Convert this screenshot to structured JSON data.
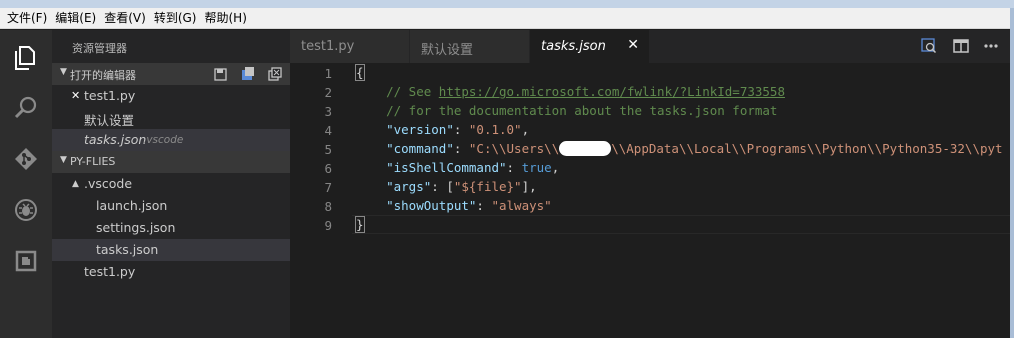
{
  "menu": [
    "文件(F)",
    "编辑(E)",
    "查看(V)",
    "转到(G)",
    "帮助(H)"
  ],
  "activity": [
    "explorer-icon",
    "search-icon",
    "git-icon",
    "debug-icon",
    "extensions-icon"
  ],
  "sidebar": {
    "title": "资源管理器",
    "open_editors": {
      "label": "打开的编辑器",
      "items": [
        {
          "close": "✕",
          "label": "test1.py"
        },
        {
          "label": "默认设置"
        },
        {
          "label": "tasks.json",
          "hint": ".vscode"
        }
      ]
    },
    "folder": {
      "label": "PY-FLIES",
      "vscode": {
        "arrow": "▲",
        "label": ".vscode"
      },
      "files": [
        "launch.json",
        "settings.json",
        "tasks.json"
      ],
      "root_file": "test1.py"
    }
  },
  "tabs": [
    {
      "label": "test1.py"
    },
    {
      "label": "默认设置"
    },
    {
      "label": "tasks.json",
      "close": "✕"
    }
  ],
  "editor": {
    "line_numbers": [
      "1",
      "2",
      "3",
      "4",
      "5",
      "6",
      "7",
      "8",
      "9"
    ],
    "open_brace": "{",
    "comment_see": "// See ",
    "link": "https://go.microsoft.com/fwlink/?LinkId=733558",
    "comment_doc": "// for the documentation about the tasks.json format",
    "version_key": "\"version\"",
    "version_val": "\"0.1.0\"",
    "command_key": "\"command\"",
    "command_val_a": "\"C:\\\\Users\\\\",
    "command_val_b": "\\\\AppData\\\\Local\\\\Programs\\\\Python\\\\Python35-32\\\\pyt",
    "shell_key": "\"isShellCommand\"",
    "shell_val": "true",
    "args_key": "\"args\"",
    "args_val": "\"${file}\"",
    "output_key": "\"showOutput\"",
    "output_val": "\"always\"",
    "close_brace": "}"
  }
}
